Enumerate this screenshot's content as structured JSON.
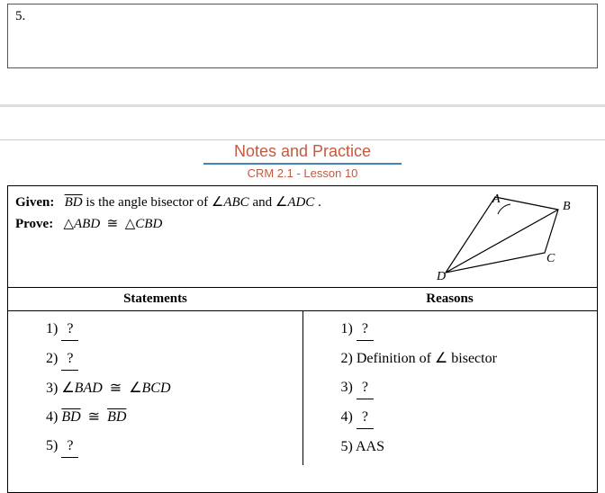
{
  "topNumber": "5.",
  "notesTitle": "Notes and Practice",
  "notesSubtitle": "CRM 2.1 - Lesson 10",
  "givenLabel": "Given:",
  "givenSeg": "BD",
  "givenText1": " is the angle bisector of ",
  "givenAng1": "ABC",
  "givenAnd": " and ",
  "givenAng2": "ADC",
  "givenPeriod": ".",
  "proveLabel": "Prove:",
  "proveTri1": "ABD",
  "proveTri2": "CBD",
  "figure": {
    "A": "A",
    "B": "B",
    "C": "C",
    "D": "D"
  },
  "headers": {
    "statements": "Statements",
    "reasons": "Reasons"
  },
  "proof": {
    "statements": {
      "s1": {
        "num": "1) ",
        "val": "?"
      },
      "s2": {
        "num": "2) ",
        "val": "?"
      },
      "s3": {
        "num": "3) ",
        "a1": "BAD",
        "a2": "BCD"
      },
      "s4": {
        "num": "4) ",
        "seg1": "BD",
        "seg2": "BD"
      },
      "s5": {
        "num": "5) ",
        "val": "?"
      }
    },
    "reasons": {
      "r1": {
        "num": "1) ",
        "val": "?"
      },
      "r2": {
        "num": "2) ",
        "text": "Definition of ",
        "angleWord": " bisector"
      },
      "r3": {
        "num": "3) ",
        "val": "?"
      },
      "r4": {
        "num": "4) ",
        "val": "?"
      },
      "r5": {
        "num": "5) ",
        "text": "AAS"
      }
    }
  }
}
